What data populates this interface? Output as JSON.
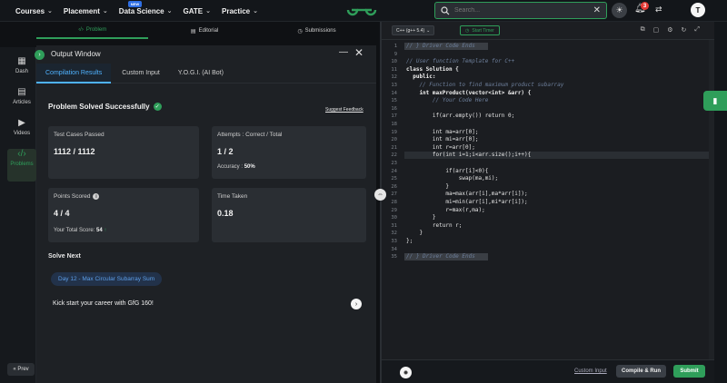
{
  "nav": {
    "items": [
      {
        "label": "Courses"
      },
      {
        "label": "Placement"
      },
      {
        "label": "Data Science",
        "badge": "NEW"
      },
      {
        "label": "GATE"
      },
      {
        "label": "Practice"
      }
    ]
  },
  "search": {
    "placeholder": "Search..."
  },
  "notifications": {
    "count": "3"
  },
  "user": {
    "initial": "T"
  },
  "problem_tabs": [
    "Problem",
    "Editorial",
    "Submissions"
  ],
  "rail": {
    "items": [
      "Dash",
      "Articles",
      "Videos",
      "Problems"
    ],
    "prev": "Prev"
  },
  "output": {
    "title": "Output Window",
    "tabs": [
      "Compilation Results",
      "Custom Input",
      "Y.O.G.I. (AI Bot)"
    ],
    "status": "Problem Solved Successfully",
    "suggest": "Suggest Feedback",
    "cards": {
      "test_cases": {
        "title": "Test Cases Passed",
        "value": "1112 / 1112"
      },
      "attempts": {
        "title": "Attempts : Correct / Total",
        "value": "1 / 2",
        "sub_label": "Accuracy :",
        "sub_value": "50%"
      },
      "points": {
        "title": "Points Scored",
        "value": "4 / 4",
        "sub_label": "Your Total Score:",
        "sub_value": "54"
      },
      "time": {
        "title": "Time Taken",
        "value": "0.18"
      }
    },
    "solve_next": "Solve Next",
    "next_problem": "Day 12 - Max Circular Subarray Sum",
    "kick_start": "Kick start your career with GfG 160!"
  },
  "editor": {
    "language": "C++ (g++ 5.4)",
    "timer": "Start Timer",
    "lines": [
      {
        "n": "1",
        "t": "// } Driver Code Ends",
        "cls": "cm",
        "hl": true
      },
      {
        "n": "9",
        "t": ""
      },
      {
        "n": "10",
        "t": "// User function Template for C++",
        "cls": "cm"
      },
      {
        "n": "11",
        "t": "class Solution {",
        "cls": "k"
      },
      {
        "n": "12",
        "t": "  public:",
        "cls": "k"
      },
      {
        "n": "13",
        "t": "    // Function to find maximum product subarray",
        "cls": "cm"
      },
      {
        "n": "14",
        "t": "    int maxProduct(vector<int> &arr) {",
        "cls": "k"
      },
      {
        "n": "15",
        "t": "        // Your Code Here",
        "cls": "cm"
      },
      {
        "n": "16",
        "t": ""
      },
      {
        "n": "17",
        "t": "        if(arr.empty()) return 0;"
      },
      {
        "n": "18",
        "t": ""
      },
      {
        "n": "19",
        "t": "        int ma=arr[0];"
      },
      {
        "n": "20",
        "t": "        int mi=arr[0];"
      },
      {
        "n": "21",
        "t": "        int r=arr[0];"
      },
      {
        "n": "22",
        "t": "        for(int i=1;i<arr.size();i++){",
        "hl2": true
      },
      {
        "n": "23",
        "t": ""
      },
      {
        "n": "24",
        "t": "            if(arr[i]<0){"
      },
      {
        "n": "25",
        "t": "                swap(ma,mi);"
      },
      {
        "n": "26",
        "t": "            }"
      },
      {
        "n": "27",
        "t": "            ma=max(arr[i],ma*arr[i]);"
      },
      {
        "n": "28",
        "t": "            mi=min(arr[i],mi*arr[i]);"
      },
      {
        "n": "29",
        "t": "            r=max(r,ma);"
      },
      {
        "n": "30",
        "t": "        }"
      },
      {
        "n": "31",
        "t": "        return r;"
      },
      {
        "n": "32",
        "t": "    }"
      },
      {
        "n": "33",
        "t": "};"
      },
      {
        "n": "34",
        "t": ""
      },
      {
        "n": "35",
        "t": "// } Driver Code Ends",
        "cls": "cm",
        "hl": true
      }
    ],
    "custom_input": "Custom Input",
    "compile": "Compile & Run",
    "submit": "Submit"
  },
  "colors": {
    "accent": "#2f9e5a",
    "link": "#4fb2ff",
    "bg": "#1e2125"
  }
}
